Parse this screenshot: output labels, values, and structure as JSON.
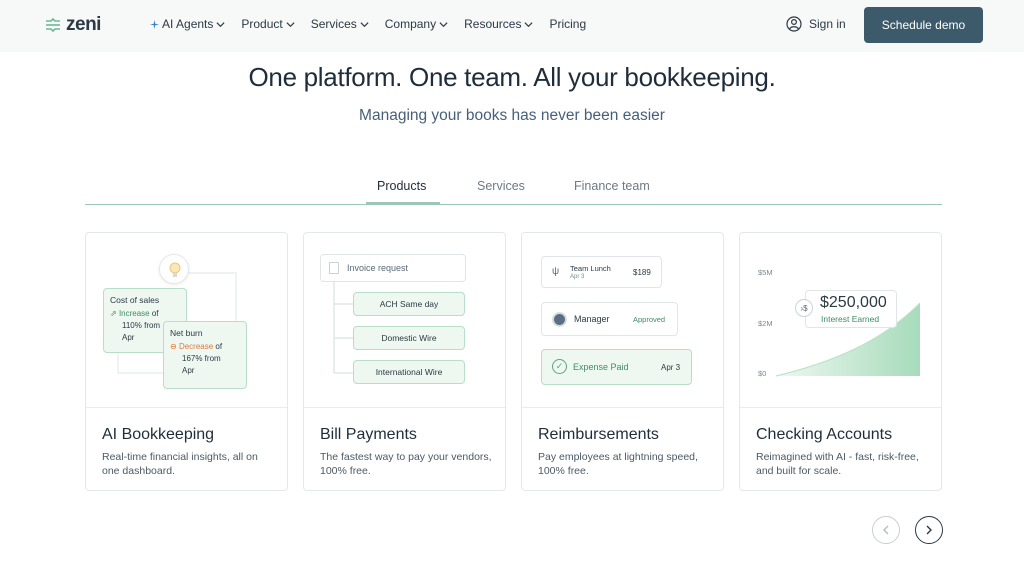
{
  "nav": {
    "logo_text": "zeni",
    "menu": [
      "AI Agents",
      "Product",
      "Services",
      "Company",
      "Resources",
      "Pricing"
    ],
    "signin_label": "Sign in",
    "demo_label": "Schedule demo"
  },
  "hero": {
    "title": "One platform. One team. All your bookkeeping.",
    "subtitle": "Managing your books has never been easier"
  },
  "tabs": [
    "Products",
    "Services",
    "Finance team"
  ],
  "cards": [
    {
      "title": "AI Bookkeeping",
      "desc": "Real-time financial insights, all on one dashboard.",
      "visual": {
        "a_title": "Cost of sales",
        "a_kind": "Increase",
        "a_of": "of",
        "a_line2": "110% from",
        "a_line3": "Apr",
        "b_title": "Net burn",
        "b_kind": "Decrease",
        "b_of": "of",
        "b_line2": "167% from",
        "b_line3": "Apr"
      }
    },
    {
      "title": "Bill Payments",
      "desc": "The fastest way to pay your vendors, 100% free.",
      "visual": {
        "request": "Invoice request",
        "options": [
          "ACH Same day",
          "Domestic Wire",
          "International Wire"
        ]
      }
    },
    {
      "title": "Reimbursements",
      "desc": "Pay employees at lightning speed, 100% free.",
      "visual": {
        "lunch": "Team Lunch",
        "lunch_date": "Apr 3",
        "lunch_amount": "$189",
        "manager": "Manager",
        "status": "Approved",
        "paid": "Expense Paid",
        "paid_date": "Apr 3"
      }
    },
    {
      "title": "Checking Accounts",
      "desc": "Reimagined with AI - fast, risk-free, and built for scale.",
      "visual": {
        "y_labels": [
          "$5M",
          "$2M",
          "$0"
        ],
        "amount": "$250,000",
        "amount_label": "Interest Earned"
      }
    }
  ],
  "colors": {
    "primary": "#3d5a6b",
    "accent_green": "#9cc7b4",
    "increase": "#3f8c66",
    "decrease": "#d87a3c"
  }
}
